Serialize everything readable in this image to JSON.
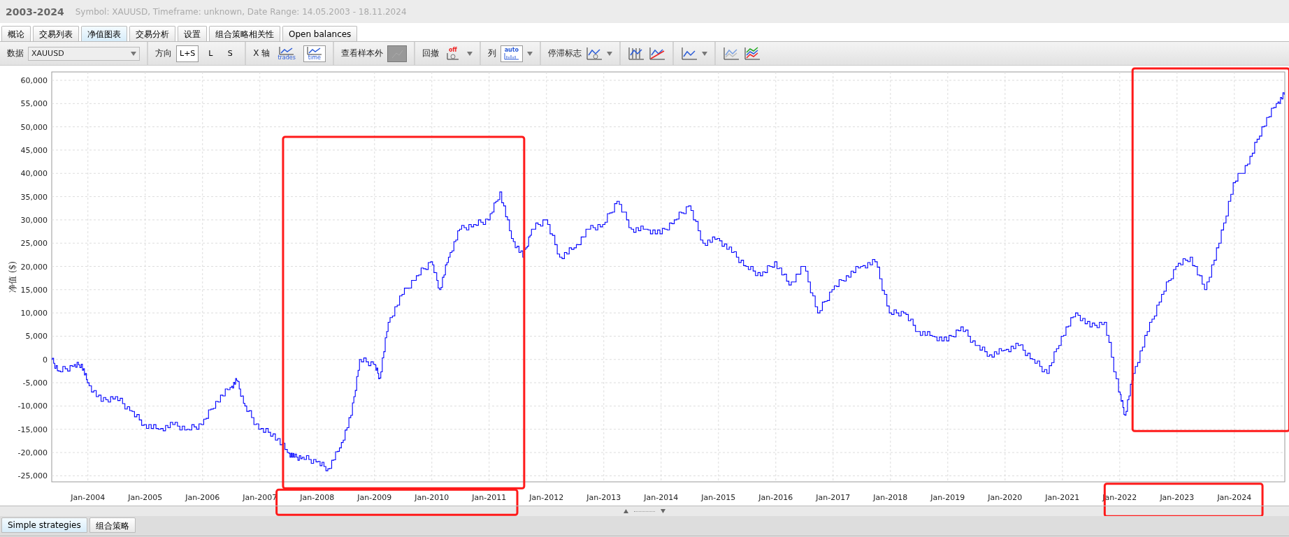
{
  "window": {
    "title": "2003-2024",
    "subtitle": "Symbol: XAUUSD, Timeframe: unknown, Date Range: 14.05.2003 - 18.11.2024"
  },
  "tabs": [
    {
      "label": "概论",
      "selected": false
    },
    {
      "label": "交易列表",
      "selected": false
    },
    {
      "label": "净值图表",
      "selected": true
    },
    {
      "label": "交易分析",
      "selected": false
    },
    {
      "label": "设置",
      "selected": false
    },
    {
      "label": "组合策略相关性",
      "selected": false
    },
    {
      "label": "Open balances",
      "selected": false
    }
  ],
  "toolbar": {
    "data_label": "数据",
    "data_select": "XAUUSD",
    "direction_label": "方向",
    "direction_options": [
      {
        "label": "L+S",
        "selected": true
      },
      {
        "label": "L",
        "selected": false
      },
      {
        "label": "S",
        "selected": false
      }
    ],
    "xaxis_label": "X 轴",
    "xaxis_options": [
      {
        "label": "trades",
        "selected": false
      },
      {
        "label": "time",
        "selected": true
      }
    ],
    "out_of_sample_label": "查看样本外",
    "drawdown_label": "回撤",
    "drawdown_badge": "off",
    "columns_label": "列",
    "columns_badge": "auto",
    "stagnation_label": "停滞标志"
  },
  "chart": {
    "chart_data": {
      "type": "line",
      "grid": true,
      "ylabel": "净值 ($)",
      "xlim": [
        "2003-05-14",
        "2024-11-18"
      ],
      "ylim": [
        -26300,
        61800
      ],
      "xticks": [
        {
          "value": "2004-01-01",
          "label": "Jan-2004"
        },
        {
          "value": "2005-01-01",
          "label": "Jan-2005"
        },
        {
          "value": "2006-01-01",
          "label": "Jan-2006"
        },
        {
          "value": "2007-01-01",
          "label": "Jan-2007"
        },
        {
          "value": "2008-01-01",
          "label": "Jan-2008"
        },
        {
          "value": "2009-01-01",
          "label": "Jan-2009"
        },
        {
          "value": "2010-01-01",
          "label": "Jan-2010"
        },
        {
          "value": "2011-01-01",
          "label": "Jan-2011"
        },
        {
          "value": "2012-01-01",
          "label": "Jan-2012"
        },
        {
          "value": "2013-01-01",
          "label": "Jan-2013"
        },
        {
          "value": "2014-01-01",
          "label": "Jan-2014"
        },
        {
          "value": "2015-01-01",
          "label": "Jan-2015"
        },
        {
          "value": "2016-01-01",
          "label": "Jan-2016"
        },
        {
          "value": "2017-01-01",
          "label": "Jan-2017"
        },
        {
          "value": "2018-01-01",
          "label": "Jan-2018"
        },
        {
          "value": "2019-01-01",
          "label": "Jan-2019"
        },
        {
          "value": "2020-01-01",
          "label": "Jan-2020"
        },
        {
          "value": "2021-01-01",
          "label": "Jan-2021"
        },
        {
          "value": "2022-01-01",
          "label": "Jan-2022"
        },
        {
          "value": "2023-01-01",
          "label": "Jan-2023"
        },
        {
          "value": "2024-01-01",
          "label": "Jan-2024"
        }
      ],
      "yticks": [
        {
          "value": 60000,
          "label": "60,000"
        },
        {
          "value": 55000,
          "label": "55,000"
        },
        {
          "value": 50000,
          "label": "50,000"
        },
        {
          "value": 45000,
          "label": "45,000"
        },
        {
          "value": 40000,
          "label": "40,000"
        },
        {
          "value": 35000,
          "label": "35,000"
        },
        {
          "value": 30000,
          "label": "30,000"
        },
        {
          "value": 25000,
          "label": "25,000"
        },
        {
          "value": 20000,
          "label": "20,000"
        },
        {
          "value": 15000,
          "label": "15,000"
        },
        {
          "value": 10000,
          "label": "10,000"
        },
        {
          "value": 5000,
          "label": "5,000"
        },
        {
          "value": 0,
          "label": "0"
        },
        {
          "value": -5000,
          "label": "-5,000"
        },
        {
          "value": -10000,
          "label": "-10,000"
        },
        {
          "value": -15000,
          "label": "-15,000"
        },
        {
          "value": -20000,
          "label": "-20,000"
        },
        {
          "value": -25000,
          "label": "-25,000"
        }
      ],
      "x": [
        "2003-05-14",
        "2003-07-01",
        "2003-10-01",
        "2003-11-24",
        "2004-01-01",
        "2004-04-01",
        "2004-07-01",
        "2004-10-01",
        "2005-01-01",
        "2005-04-01",
        "2005-07-01",
        "2005-10-01",
        "2006-01-01",
        "2006-04-01",
        "2006-07-01",
        "2006-08-08",
        "2006-10-01",
        "2007-01-01",
        "2007-04-01",
        "2007-07-01",
        "2007-08-08",
        "2007-10-01",
        "2008-01-01",
        "2008-03-14",
        "2008-05-27",
        "2008-08-08",
        "2008-10-01",
        "2009-01-01",
        "2009-02-06",
        "2009-04-01",
        "2009-07-01",
        "2009-10-01",
        "2010-01-01",
        "2010-02-24",
        "2010-04-20",
        "2010-07-01",
        "2010-10-01",
        "2011-01-01",
        "2011-03-14",
        "2011-05-27",
        "2011-08-08",
        "2011-10-01",
        "2012-01-01",
        "2012-04-01",
        "2012-07-01",
        "2012-10-01",
        "2013-01-01",
        "2013-04-01",
        "2013-07-01",
        "2013-10-01",
        "2014-01-01",
        "2014-04-01",
        "2014-07-01",
        "2014-10-01",
        "2015-01-01",
        "2015-04-01",
        "2015-07-01",
        "2015-10-01",
        "2016-01-01",
        "2016-04-01",
        "2016-07-01",
        "2016-10-01",
        "2017-01-01",
        "2017-04-01",
        "2017-07-01",
        "2017-10-01",
        "2018-01-01",
        "2018-04-01",
        "2018-07-01",
        "2018-10-01",
        "2019-01-01",
        "2019-04-01",
        "2019-07-01",
        "2019-10-01",
        "2020-01-01",
        "2020-04-01",
        "2020-07-01",
        "2020-10-01",
        "2021-01-01",
        "2021-04-01",
        "2021-07-01",
        "2021-10-01",
        "2022-01-01",
        "2022-02-06",
        "2022-04-01",
        "2022-07-01",
        "2022-10-01",
        "2023-01-01",
        "2023-04-01",
        "2023-07-01",
        "2023-10-01",
        "2024-01-01",
        "2024-04-01",
        "2024-07-01",
        "2024-10-01",
        "2024-11-18"
      ],
      "series": [
        {
          "color": "#0000ff",
          "values": [
            0,
            -2500,
            -1500,
            -1000,
            -5000,
            -9000,
            -8000,
            -11000,
            -14000,
            -15000,
            -14000,
            -15000,
            -14000,
            -9000,
            -6000,
            -4500,
            -10000,
            -15000,
            -16000,
            -20000,
            -21000,
            -21000,
            -22000,
            -23500,
            -19000,
            -12000,
            0,
            -1000,
            -4000,
            8000,
            14000,
            18000,
            21000,
            15000,
            22000,
            28000,
            29000,
            30000,
            36000,
            26000,
            22000,
            28000,
            30000,
            22000,
            24000,
            28000,
            29000,
            34000,
            28000,
            28000,
            27000,
            30000,
            33000,
            25000,
            26000,
            23000,
            20000,
            18000,
            21000,
            16000,
            20000,
            10000,
            15000,
            18000,
            20000,
            21000,
            10000,
            10000,
            6000,
            5000,
            4000,
            7000,
            3000,
            1000,
            2000,
            3000,
            0,
            -3000,
            5000,
            10000,
            7000,
            8000,
            -7000,
            -12000,
            -3000,
            6000,
            14000,
            20000,
            22000,
            15000,
            25000,
            38000,
            42000,
            50000,
            55000,
            57000
          ]
        }
      ]
    }
  },
  "bottom_tabs": [
    {
      "label": "Simple strategies",
      "selected": true
    },
    {
      "label": "组合策略",
      "selected": false
    }
  ]
}
